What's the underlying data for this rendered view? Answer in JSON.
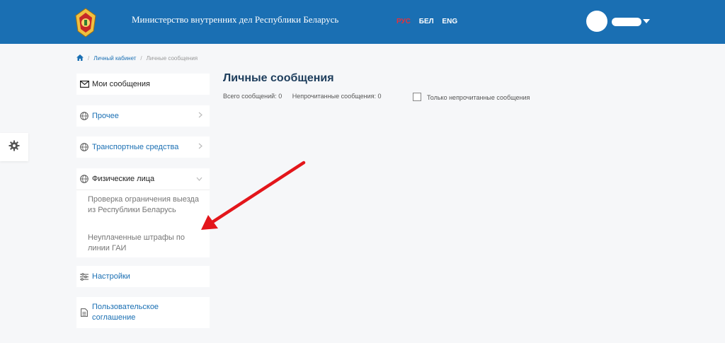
{
  "header": {
    "ministry_title": "Министерство внутренних дел Республики Беларусь",
    "languages": [
      {
        "code": "РУС",
        "active": true
      },
      {
        "code": "БЕЛ",
        "active": false
      },
      {
        "code": "ENG",
        "active": false
      }
    ],
    "colors": {
      "bar": "#1a6fb3",
      "active_lang": "#e8313a"
    }
  },
  "breadcrumb": {
    "home_icon": "home-icon",
    "link": "Личный кабинет",
    "current": "Личные сообщения"
  },
  "sidebar": {
    "items": [
      {
        "label": "Мои сообщения",
        "icon": "envelope-icon"
      },
      {
        "label": "Прочее",
        "icon": "globe-icon"
      },
      {
        "label": "Транспортные средства",
        "icon": "globe-icon"
      },
      {
        "label": "Физические лица",
        "icon": "globe-icon",
        "expanded": true,
        "subitems": [
          "Проверка ограничения выезда из Республики Беларусь",
          "Неуплаченные штрафы по линии ГАИ"
        ]
      },
      {
        "label": "Настройки",
        "icon": "sliders-icon"
      },
      {
        "label": "Пользовательское соглашение",
        "icon": "document-icon"
      }
    ]
  },
  "settings_panel": {
    "icon": "gear-icon"
  },
  "main": {
    "title": "Личные сообщения",
    "total_label": "Всего сообщений: 0",
    "unread_label": "Непрочитанные сообщения: 0",
    "filter_label": "Только непрочитанные сообщения",
    "filter_checked": false
  },
  "annotation": {
    "color": "#e3161b",
    "icon": "red-arrow-icon"
  }
}
